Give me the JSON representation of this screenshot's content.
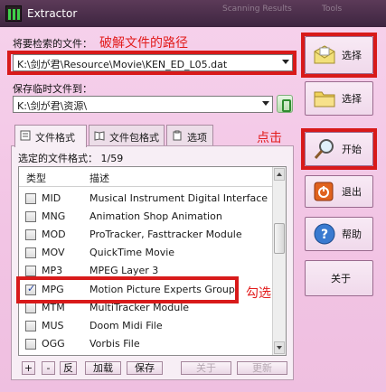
{
  "window": {
    "title": "Extractor",
    "bg_tabs": [
      "Scanning Results",
      "Tools"
    ]
  },
  "source": {
    "label": "将要检索的文件：",
    "annotation": "破解文件的路径",
    "value": "K:\\剑が君\\Resource\\Movie\\KEN_ED_L05.dat"
  },
  "temp": {
    "label": "保存临时文件到：",
    "value": "K:\\剑が君\\资源\\"
  },
  "buttons": {
    "select1": "选择",
    "select2": "选择",
    "start": "开始",
    "exit": "退出",
    "help": "帮助",
    "about": "关于"
  },
  "annotations": {
    "click": "点击",
    "check": "勾选"
  },
  "tabs": [
    {
      "label": "文件格式"
    },
    {
      "label": "文件包格式"
    },
    {
      "label": "选项"
    }
  ],
  "selected_count": "选定的文件格式： 1/59",
  "list": {
    "headers": {
      "type": "类型",
      "desc": "描述"
    },
    "rows": [
      {
        "type": "MID",
        "desc": "Musical Instrument Digital Interface",
        "checked": false
      },
      {
        "type": "MNG",
        "desc": "Animation Shop Animation",
        "checked": false
      },
      {
        "type": "MOD",
        "desc": "ProTracker, Fasttracker Module",
        "checked": false
      },
      {
        "type": "MOV",
        "desc": "QuickTime Movie",
        "checked": false
      },
      {
        "type": "MP3",
        "desc": "MPEG Layer 3",
        "checked": false
      },
      {
        "type": "MPG",
        "desc": "Motion Picture Experts Group",
        "checked": true
      },
      {
        "type": "MTM",
        "desc": "MultiTracker Module",
        "checked": false
      },
      {
        "type": "MUS",
        "desc": "Doom Midi File",
        "checked": false
      },
      {
        "type": "OGG",
        "desc": "Vorbis File",
        "checked": false
      }
    ]
  },
  "bottom": {
    "plus": "+",
    "minus": "-",
    "invert": "反",
    "load": "加载",
    "save": "保存",
    "about": "关于",
    "update": "更新"
  },
  "colors": {
    "accent_red": "#d81a1a",
    "titlebar": "#4a2e48",
    "window_bg": "#f3c8e6"
  }
}
